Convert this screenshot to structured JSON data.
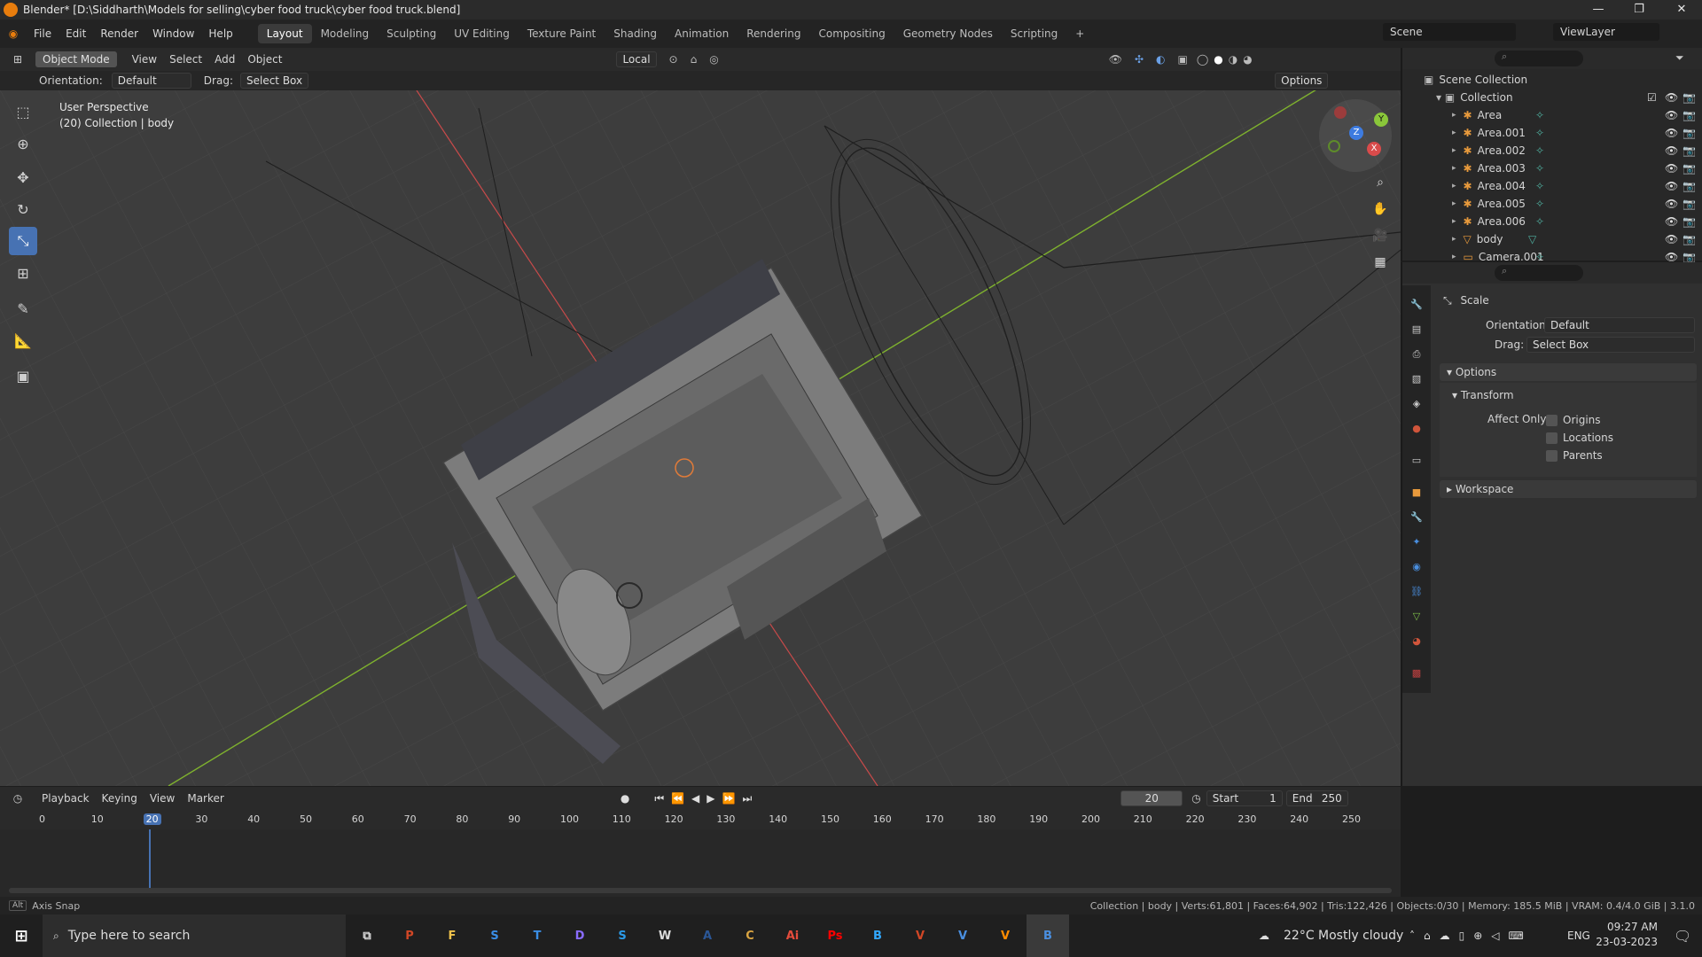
{
  "window": {
    "title": "Blender* [D:\\Siddharth\\Models for selling\\cyber food truck\\cyber food truck.blend]",
    "minimize": "—",
    "maximize": "❐",
    "close": "✕"
  },
  "menu": {
    "items": [
      "File",
      "Edit",
      "Render",
      "Window",
      "Help"
    ]
  },
  "workspaces": {
    "tabs": [
      "Layout",
      "Modeling",
      "Sculpting",
      "UV Editing",
      "Texture Paint",
      "Shading",
      "Animation",
      "Rendering",
      "Compositing",
      "Geometry Nodes",
      "Scripting"
    ],
    "add": "+"
  },
  "scene": {
    "name": "Scene",
    "view_layer": "ViewLayer"
  },
  "viewport_header": {
    "mode": "Object Mode",
    "menus": [
      "View",
      "Select",
      "Add",
      "Object"
    ],
    "transform_orientation": "Local",
    "options": "Options"
  },
  "tool_settings": {
    "orientation_label": "Orientation:",
    "orientation_value": "Default",
    "drag_label": "Drag:",
    "drag_value": "Select Box"
  },
  "overlay": {
    "line1": "User Perspective",
    "line2": "(20) Collection | body"
  },
  "gizmo": {
    "x": "X",
    "y": "Y",
    "z": "Z"
  },
  "outliner": {
    "root": "Scene Collection",
    "collection": "Collection",
    "items": [
      "Area",
      "Area.001",
      "Area.002",
      "Area.003",
      "Area.004",
      "Area.005",
      "Area.006",
      "body",
      "Camera.001"
    ]
  },
  "properties": {
    "tool_name": "Scale",
    "orientation_label": "Orientation",
    "orientation_value": "Default",
    "drag_label": "Drag:",
    "drag_value": "Select Box",
    "options_panel": "Options",
    "transform_panel": "Transform",
    "affect_only_label": "Affect Only",
    "affect_only": [
      "Origins",
      "Locations",
      "Parents"
    ],
    "workspace_panel": "Workspace"
  },
  "timeline": {
    "menus": [
      "Playback",
      "Keying",
      "View",
      "Marker"
    ],
    "current_frame": "20",
    "start_label": "Start",
    "start": "1",
    "end_label": "End",
    "end": "250",
    "ticks": [
      "0",
      "10",
      "20",
      "30",
      "40",
      "50",
      "60",
      "70",
      "80",
      "90",
      "100",
      "110",
      "120",
      "130",
      "140",
      "150",
      "160",
      "170",
      "180",
      "190",
      "200",
      "210",
      "220",
      "230",
      "240",
      "250"
    ]
  },
  "status": {
    "left": "Axis Snap",
    "right": "Collection | body | Verts:61,801 | Faces:64,902 | Tris:122,426 | Objects:0/30 | Memory: 185.5 MiB | VRAM: 0.4/4.0 GiB | 3.1.0"
  },
  "taskbar": {
    "search_placeholder": "Type here to search",
    "weather": "22°C  Mostly cloudy",
    "language": "ENG",
    "time": "09:27 AM",
    "date": "23-03-2023",
    "apps": [
      "P",
      "F",
      "S",
      "T",
      "D",
      "S",
      "W",
      "A",
      "C",
      "Ai",
      "Ps",
      "B",
      "V",
      "V",
      "V",
      "B"
    ]
  },
  "colors": {
    "accent": "#4772b3",
    "x_axis": "#d94b4b",
    "y_axis": "#8ac73a",
    "blender_orange": "#e87d0d"
  }
}
